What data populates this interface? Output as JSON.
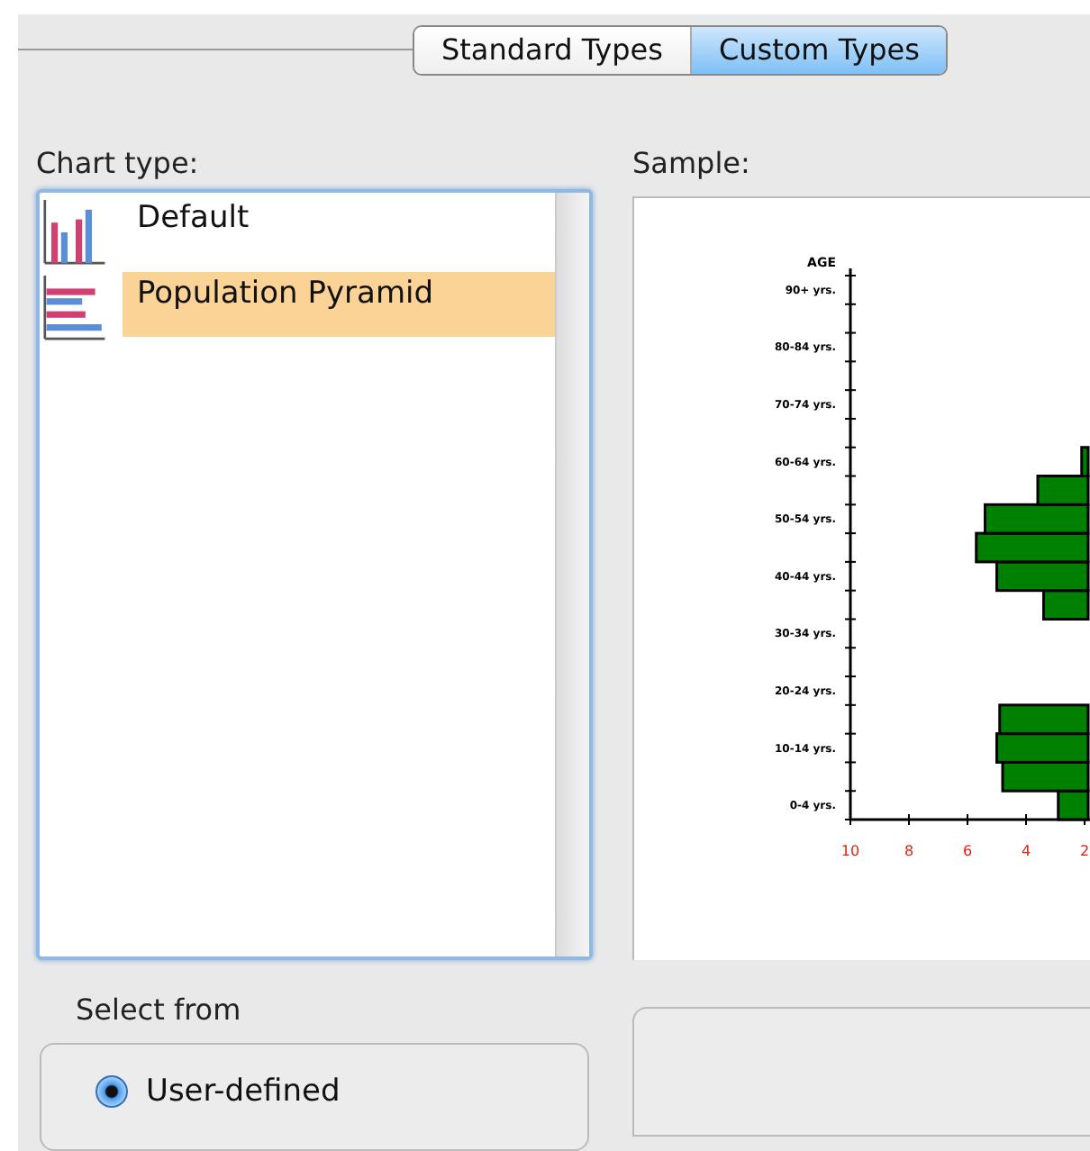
{
  "tabs": [
    {
      "label": "Standard Types",
      "selected": false
    },
    {
      "label": "Custom Types",
      "selected": true
    }
  ],
  "chart_type": {
    "label": "Chart type:",
    "items": [
      {
        "label": "Default",
        "kind": "columns",
        "selected": false
      },
      {
        "label": "Population Pyramid",
        "kind": "pyramid",
        "selected": true
      }
    ]
  },
  "sample": {
    "label": "Sample:",
    "axis_title": "AGE",
    "age_labels": [
      "90+ yrs.",
      "80-84 yrs.",
      "70-74 yrs.",
      "60-64 yrs.",
      "50-54 yrs.",
      "40-44 yrs.",
      "30-34 yrs.",
      "20-24 yrs.",
      "10-14 yrs.",
      "0-4 yrs."
    ],
    "tick_labels": [
      "10",
      "8",
      "6",
      "4",
      "2"
    ]
  },
  "select_from": {
    "label": "Select from",
    "options": [
      {
        "label": "User-defined",
        "selected": true
      }
    ]
  }
}
